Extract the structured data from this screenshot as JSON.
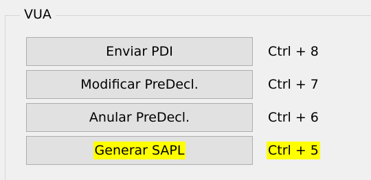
{
  "group": {
    "title": "VUA"
  },
  "actions": [
    {
      "label": "Enviar PDI",
      "shortcut": "Ctrl + 8",
      "highlighted": false
    },
    {
      "label": "Modificar PreDecl.",
      "shortcut": "Ctrl + 7",
      "highlighted": false
    },
    {
      "label": "Anular PreDecl.",
      "shortcut": "Ctrl + 6",
      "highlighted": false
    },
    {
      "label": "Generar SAPL",
      "shortcut": "Ctrl + 5",
      "highlighted": true
    }
  ],
  "colors": {
    "highlight": "#ffff00",
    "button_face": "#e1e1e1",
    "button_border": "#adadad"
  }
}
